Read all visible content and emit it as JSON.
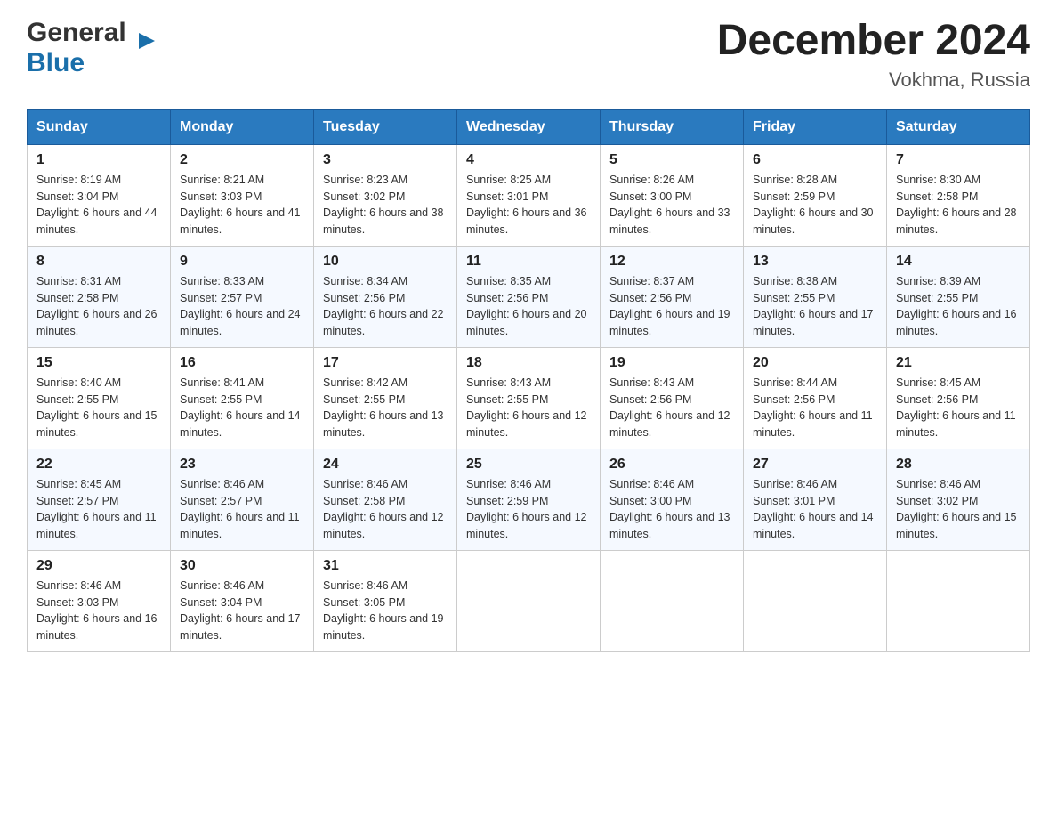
{
  "header": {
    "logo_general": "General",
    "logo_blue": "Blue",
    "month_year": "December 2024",
    "location": "Vokhma, Russia"
  },
  "days_of_week": [
    "Sunday",
    "Monday",
    "Tuesday",
    "Wednesday",
    "Thursday",
    "Friday",
    "Saturday"
  ],
  "weeks": [
    [
      {
        "day": "1",
        "sunrise": "8:19 AM",
        "sunset": "3:04 PM",
        "daylight": "6 hours and 44 minutes."
      },
      {
        "day": "2",
        "sunrise": "8:21 AM",
        "sunset": "3:03 PM",
        "daylight": "6 hours and 41 minutes."
      },
      {
        "day": "3",
        "sunrise": "8:23 AM",
        "sunset": "3:02 PM",
        "daylight": "6 hours and 38 minutes."
      },
      {
        "day": "4",
        "sunrise": "8:25 AM",
        "sunset": "3:01 PM",
        "daylight": "6 hours and 36 minutes."
      },
      {
        "day": "5",
        "sunrise": "8:26 AM",
        "sunset": "3:00 PM",
        "daylight": "6 hours and 33 minutes."
      },
      {
        "day": "6",
        "sunrise": "8:28 AM",
        "sunset": "2:59 PM",
        "daylight": "6 hours and 30 minutes."
      },
      {
        "day": "7",
        "sunrise": "8:30 AM",
        "sunset": "2:58 PM",
        "daylight": "6 hours and 28 minutes."
      }
    ],
    [
      {
        "day": "8",
        "sunrise": "8:31 AM",
        "sunset": "2:58 PM",
        "daylight": "6 hours and 26 minutes."
      },
      {
        "day": "9",
        "sunrise": "8:33 AM",
        "sunset": "2:57 PM",
        "daylight": "6 hours and 24 minutes."
      },
      {
        "day": "10",
        "sunrise": "8:34 AM",
        "sunset": "2:56 PM",
        "daylight": "6 hours and 22 minutes."
      },
      {
        "day": "11",
        "sunrise": "8:35 AM",
        "sunset": "2:56 PM",
        "daylight": "6 hours and 20 minutes."
      },
      {
        "day": "12",
        "sunrise": "8:37 AM",
        "sunset": "2:56 PM",
        "daylight": "6 hours and 19 minutes."
      },
      {
        "day": "13",
        "sunrise": "8:38 AM",
        "sunset": "2:55 PM",
        "daylight": "6 hours and 17 minutes."
      },
      {
        "day": "14",
        "sunrise": "8:39 AM",
        "sunset": "2:55 PM",
        "daylight": "6 hours and 16 minutes."
      }
    ],
    [
      {
        "day": "15",
        "sunrise": "8:40 AM",
        "sunset": "2:55 PM",
        "daylight": "6 hours and 15 minutes."
      },
      {
        "day": "16",
        "sunrise": "8:41 AM",
        "sunset": "2:55 PM",
        "daylight": "6 hours and 14 minutes."
      },
      {
        "day": "17",
        "sunrise": "8:42 AM",
        "sunset": "2:55 PM",
        "daylight": "6 hours and 13 minutes."
      },
      {
        "day": "18",
        "sunrise": "8:43 AM",
        "sunset": "2:55 PM",
        "daylight": "6 hours and 12 minutes."
      },
      {
        "day": "19",
        "sunrise": "8:43 AM",
        "sunset": "2:56 PM",
        "daylight": "6 hours and 12 minutes."
      },
      {
        "day": "20",
        "sunrise": "8:44 AM",
        "sunset": "2:56 PM",
        "daylight": "6 hours and 11 minutes."
      },
      {
        "day": "21",
        "sunrise": "8:45 AM",
        "sunset": "2:56 PM",
        "daylight": "6 hours and 11 minutes."
      }
    ],
    [
      {
        "day": "22",
        "sunrise": "8:45 AM",
        "sunset": "2:57 PM",
        "daylight": "6 hours and 11 minutes."
      },
      {
        "day": "23",
        "sunrise": "8:46 AM",
        "sunset": "2:57 PM",
        "daylight": "6 hours and 11 minutes."
      },
      {
        "day": "24",
        "sunrise": "8:46 AM",
        "sunset": "2:58 PM",
        "daylight": "6 hours and 12 minutes."
      },
      {
        "day": "25",
        "sunrise": "8:46 AM",
        "sunset": "2:59 PM",
        "daylight": "6 hours and 12 minutes."
      },
      {
        "day": "26",
        "sunrise": "8:46 AM",
        "sunset": "3:00 PM",
        "daylight": "6 hours and 13 minutes."
      },
      {
        "day": "27",
        "sunrise": "8:46 AM",
        "sunset": "3:01 PM",
        "daylight": "6 hours and 14 minutes."
      },
      {
        "day": "28",
        "sunrise": "8:46 AM",
        "sunset": "3:02 PM",
        "daylight": "6 hours and 15 minutes."
      }
    ],
    [
      {
        "day": "29",
        "sunrise": "8:46 AM",
        "sunset": "3:03 PM",
        "daylight": "6 hours and 16 minutes."
      },
      {
        "day": "30",
        "sunrise": "8:46 AM",
        "sunset": "3:04 PM",
        "daylight": "6 hours and 17 minutes."
      },
      {
        "day": "31",
        "sunrise": "8:46 AM",
        "sunset": "3:05 PM",
        "daylight": "6 hours and 19 minutes."
      },
      null,
      null,
      null,
      null
    ]
  ]
}
